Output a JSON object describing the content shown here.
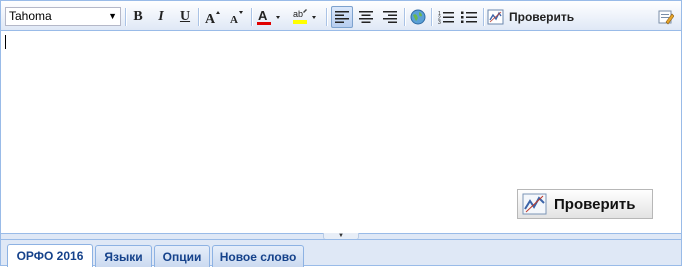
{
  "toolbar": {
    "font_name": "Tahoma",
    "bold_label": "B",
    "italic_label": "I",
    "underline_label": "U",
    "check_label": "Проверить"
  },
  "editor": {
    "check_button_label": "Проверить"
  },
  "tabs": [
    {
      "label": "ОРФО 2016",
      "active": true
    },
    {
      "label": "Языки",
      "active": false
    },
    {
      "label": "Опции",
      "active": false
    },
    {
      "label": "Новое слово",
      "active": false
    }
  ],
  "colors": {
    "font_color_bar": "#e00000",
    "highlight_color_bar": "#ffff00",
    "border": "#99bbe8",
    "tab_text": "#15428b"
  }
}
